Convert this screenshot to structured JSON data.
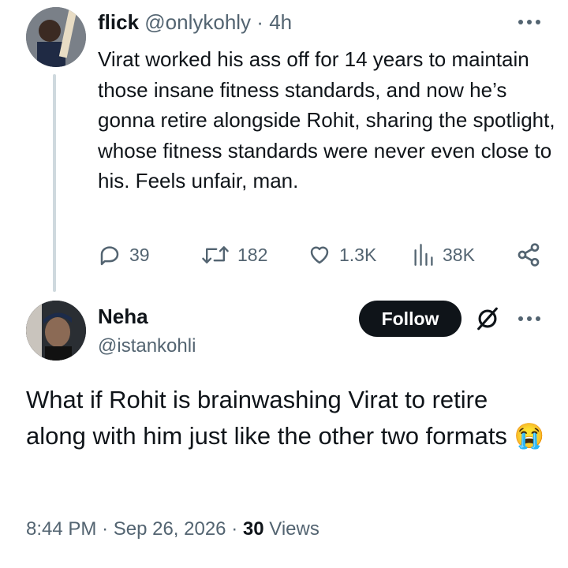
{
  "parent_tweet": {
    "display_name": "flick",
    "handle": "@onlykohly",
    "separator": "·",
    "time": "4h",
    "text": "Virat worked his ass off for 14 years to maintain those insane fitness standards, and now he’s gonna retire alongside Rohit, sharing the spotlight, whose fitness standards were never even close to his. Feels unfair, man.",
    "stats": {
      "replies": "39",
      "reposts": "182",
      "likes": "1.3K",
      "views": "38K"
    }
  },
  "reply_tweet": {
    "display_name": "Neha",
    "handle": "@istankohli",
    "follow_label": "Follow",
    "text": "What if Rohit is brainwashing Virat to retire along with him just like the other two formats",
    "emoji": "😭",
    "time": "8:44 PM",
    "separator": "·",
    "date": "Sep 26, 2026",
    "views_count": "30",
    "views_label": "Views"
  },
  "colors": {
    "text_primary": "#0f1419",
    "text_secondary": "#536471",
    "thread_line": "#cfd9de",
    "follow_bg": "#0f1419"
  },
  "icons": [
    "reply-icon",
    "repost-icon",
    "like-icon",
    "views-icon",
    "share-icon",
    "more-icon",
    "grok-icon"
  ]
}
